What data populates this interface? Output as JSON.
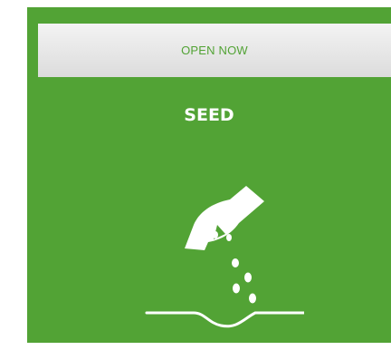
{
  "card": {
    "action_label": "OPEN NOW",
    "title": "SEED",
    "icon": "hand-sowing-seed-icon",
    "colors": {
      "card_background": "#52a335",
      "action_bar": "#e6e6e6",
      "action_text": "#52a335",
      "title_text": "#ffffff"
    }
  }
}
